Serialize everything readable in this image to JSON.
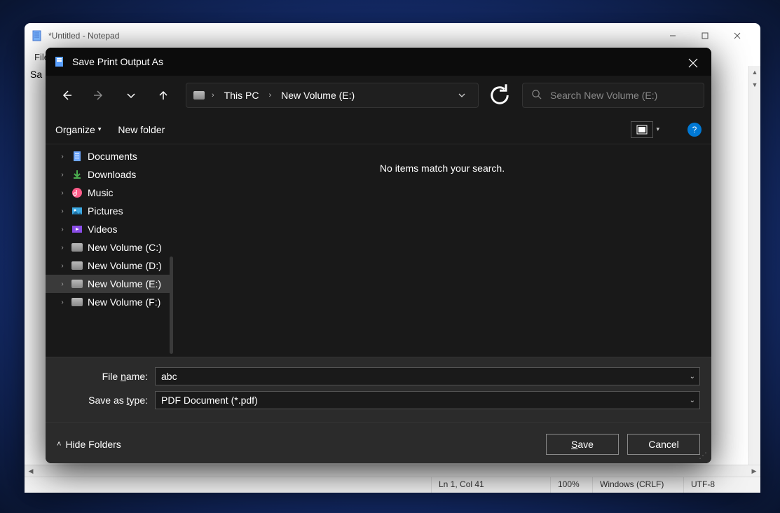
{
  "notepad": {
    "title": "*Untitled - Notepad",
    "menu_file": "File",
    "content_fragment": "Sa",
    "status": {
      "position": "Ln 1, Col 41",
      "zoom": "100%",
      "line_ending": "Windows (CRLF)",
      "encoding": "UTF-8"
    }
  },
  "dialog": {
    "title": "Save Print Output As",
    "breadcrumbs": [
      "This PC",
      "New Volume (E:)"
    ],
    "search_placeholder": "Search New Volume (E:)",
    "toolbar": {
      "organize": "Organize",
      "new_folder": "New folder"
    },
    "tree": [
      {
        "label": "Documents",
        "icon": "document-icon",
        "selected": false
      },
      {
        "label": "Downloads",
        "icon": "download-icon",
        "selected": false
      },
      {
        "label": "Music",
        "icon": "music-icon",
        "selected": false
      },
      {
        "label": "Pictures",
        "icon": "pictures-icon",
        "selected": false
      },
      {
        "label": "Videos",
        "icon": "videos-icon",
        "selected": false
      },
      {
        "label": "New Volume (C:)",
        "icon": "drive-icon",
        "selected": false
      },
      {
        "label": "New Volume (D:)",
        "icon": "drive-icon",
        "selected": false
      },
      {
        "label": "New Volume (E:)",
        "icon": "drive-icon",
        "selected": true
      },
      {
        "label": "New Volume (F:)",
        "icon": "drive-icon",
        "selected": false
      }
    ],
    "empty_message": "No items match your search.",
    "file_name_label": "File name:",
    "file_name_value": "abc",
    "save_type_label": "Save as type:",
    "save_type_value": "PDF Document (*.pdf)",
    "hide_folders": "Hide Folders",
    "save_btn": "Save",
    "cancel_btn": "Cancel"
  }
}
